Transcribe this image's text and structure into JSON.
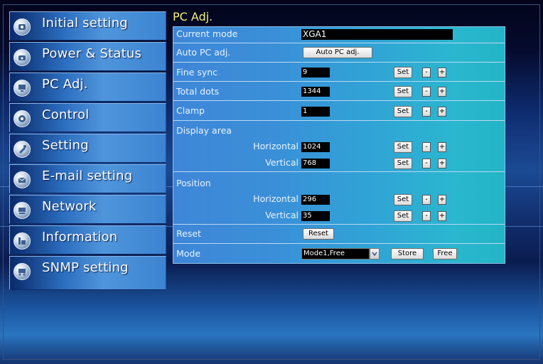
{
  "sidebar": {
    "items": [
      {
        "label": "Initial setting",
        "icon": "initial-setting-icon"
      },
      {
        "label": "Power & Status",
        "icon": "power-status-icon"
      },
      {
        "label": "PC Adj.",
        "icon": "pc-adj-icon"
      },
      {
        "label": "Control",
        "icon": "control-icon"
      },
      {
        "label": "Setting",
        "icon": "setting-icon"
      },
      {
        "label": "E-mail setting",
        "icon": "email-icon"
      },
      {
        "label": "Network",
        "icon": "network-icon"
      },
      {
        "label": "Information",
        "icon": "information-icon"
      },
      {
        "label": "SNMP setting",
        "icon": "snmp-icon"
      }
    ]
  },
  "page": {
    "title": "PC Adj."
  },
  "form": {
    "current_mode": {
      "label": "Current mode",
      "value": "XGA1"
    },
    "auto_pc_adj": {
      "label": "Auto PC adj.",
      "button": "Auto PC adj."
    },
    "fine_sync": {
      "label": "Fine sync",
      "value": "9"
    },
    "total_dots": {
      "label": "Total dots",
      "value": "1344"
    },
    "clamp": {
      "label": "Clamp",
      "value": "1"
    },
    "display_area": {
      "label": "Display area",
      "horizontal": {
        "label": "Horizontal",
        "value": "1024"
      },
      "vertical": {
        "label": "Vertical",
        "value": "768"
      }
    },
    "position": {
      "label": "Position",
      "horizontal": {
        "label": "Horizontal",
        "value": "296"
      },
      "vertical": {
        "label": "Vertical",
        "value": "35"
      }
    },
    "reset": {
      "label": "Reset",
      "button": "Reset"
    },
    "mode": {
      "label": "Mode",
      "selected": "Mode1,Free",
      "store": "Store",
      "free": "Free"
    },
    "set_label": "Set",
    "minus_label": "-",
    "plus_label": "+"
  },
  "colors": {
    "title": "#f2f07a",
    "panel": "#3a8fd8",
    "sidebar": "#2c6fc0"
  }
}
